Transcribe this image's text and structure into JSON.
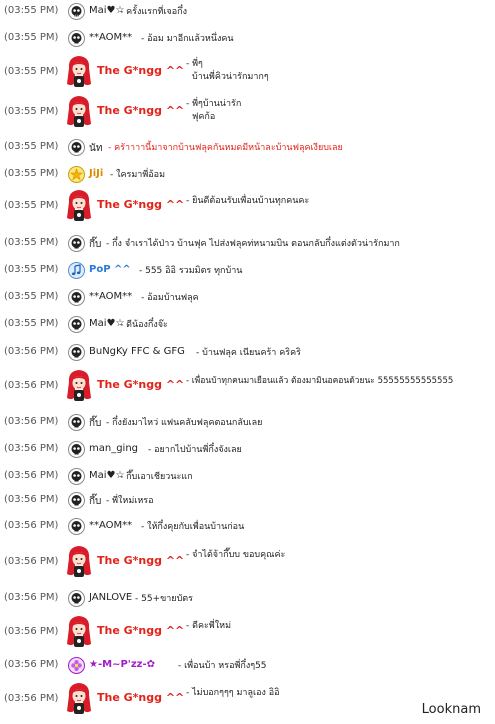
{
  "colors": {
    "gang_name": "#e2231a",
    "pop_name": "#2a7bd8",
    "jiji_name": "#d98a00",
    "mp_name": "#a21cc8",
    "time": "#555555"
  },
  "messages": [
    {
      "time": "(03:55 PM)",
      "icon": "skull-icon",
      "nick": "Mai♥☆",
      "text": "- ครั้งแรกที่เจอกึ๋ง"
    },
    {
      "time": "(03:55 PM)",
      "icon": "skull-icon",
      "nick": "**AOM**",
      "text": "- อ้อม มาอีกแล้วหนึ่งคน"
    },
    {
      "time": "(03:55 PM)",
      "icon": "red-hair-avatar",
      "nick": "The G*ngg ^^",
      "text": "- พี่ๆ",
      "text2": "บ้านพี่คิวน่ารักมากๆ"
    },
    {
      "time": "(03:55 PM)",
      "icon": "red-hair-avatar",
      "nick": "The G*ngg ^^",
      "text": "- พี่ๆบ้านน่ารัก",
      "text2": "ฟุคก้อ"
    },
    {
      "time": "(03:55 PM)",
      "icon": "skull-icon",
      "nick": "นัท",
      "text": "- ครัาาาานี้มาจากบ้านฟลุคกันหมดมีหน้าละบ้านฟลุคเงียบเลย",
      "red": true
    },
    {
      "time": "(03:55 PM)",
      "icon": "star-icon",
      "nick": "JiJi",
      "text": "- ใครมาพี่อ้อม"
    },
    {
      "time": "(03:55 PM)",
      "icon": "red-hair-avatar",
      "nick": "The G*ngg ^^",
      "text": "- ยินดีต้อนรับเพื่อนบ้านทุกคนคะ"
    },
    {
      "time": "(03:55 PM)",
      "icon": "skull-icon",
      "nick": "กึ๊บ",
      "text": "- กึ๋ง จำเราได้ป่าว บ้านฟุค ไปส่งฟลุคท่หนามบิน ตอนกลับกึ๋งแต่งตัวน่ารักมาก"
    },
    {
      "time": "(03:55 PM)",
      "icon": "music-note-icon",
      "nick": "PoP ^^",
      "text": "- 555 อิอิ รวมมิตร ทุกบ้าน"
    },
    {
      "time": "(03:55 PM)",
      "icon": "skull-icon",
      "nick": "**AOM**",
      "text": "- อ้อมบ้านฟลุค"
    },
    {
      "time": "(03:55 PM)",
      "icon": "skull-icon",
      "nick": "Mai♥☆",
      "text": "- ดีน้องกึ๋งจ๊ะ"
    },
    {
      "time": "(03:56 PM)",
      "icon": "skull-icon",
      "nick": "BuNgKy FFC & GFG",
      "text": "- บ้านฟลุค เนียนคร้า คริคริ"
    },
    {
      "time": "(03:56 PM)",
      "icon": "red-hair-avatar",
      "nick": "The G*ngg ^^",
      "text": "- เพื่อนบ้าทุกคนมาเยือนแล้ว ต้องมามินอคอนด้วยนะ 55555555555555"
    },
    {
      "time": "(03:56 PM)",
      "icon": "skull-icon",
      "nick": "กึ๊บ",
      "text": "- กึ๋งยังมาไหว่ แฟนคลับฟลุคตอนกลับเลย"
    },
    {
      "time": "(03:56 PM)",
      "icon": "skull-icon",
      "nick": "man_ging",
      "text": "- อยากไปบ้านพี่กึ๋งจังเลย"
    },
    {
      "time": "(03:56 PM)",
      "icon": "skull-icon",
      "nick": "Mai♥☆",
      "text": "- กึ๊บเอาเชียวนะแก"
    },
    {
      "time": "(03:56 PM)",
      "icon": "skull-icon",
      "nick": "กึ๊บ",
      "text": "- พี่ใหม่เหรอ"
    },
    {
      "time": "(03:56 PM)",
      "icon": "skull-icon",
      "nick": "**AOM**",
      "text": "- ให้กึ๋งคุยกับเพื่อนบ้านก่อน"
    },
    {
      "time": "(03:56 PM)",
      "icon": "red-hair-avatar",
      "nick": "The G*ngg ^^",
      "text": "- จำได้จ้ากึ๊บบ ขอบคุณค่ะ"
    },
    {
      "time": "(03:56 PM)",
      "icon": "skull-icon",
      "nick": "JANLOVE",
      "text": "- 55+ขายบัตร"
    },
    {
      "time": "(03:56 PM)",
      "icon": "red-hair-avatar",
      "nick": "The G*ngg ^^",
      "text": "- ดีคะพี่ใหม่"
    },
    {
      "time": "(03:56 PM)",
      "icon": "flower-icon",
      "nick": "★-M~P'zz-✿",
      "text": "- เพื่อนบ้า หรอพี่กึ๋งๆ55"
    },
    {
      "time": "(03:56 PM)",
      "icon": "red-hair-avatar",
      "nick": "The G*ngg ^^",
      "text": "- ไม่บอกๆๆๆ มาลูเอง อิอิ"
    }
  ],
  "watermark": "Looknam"
}
